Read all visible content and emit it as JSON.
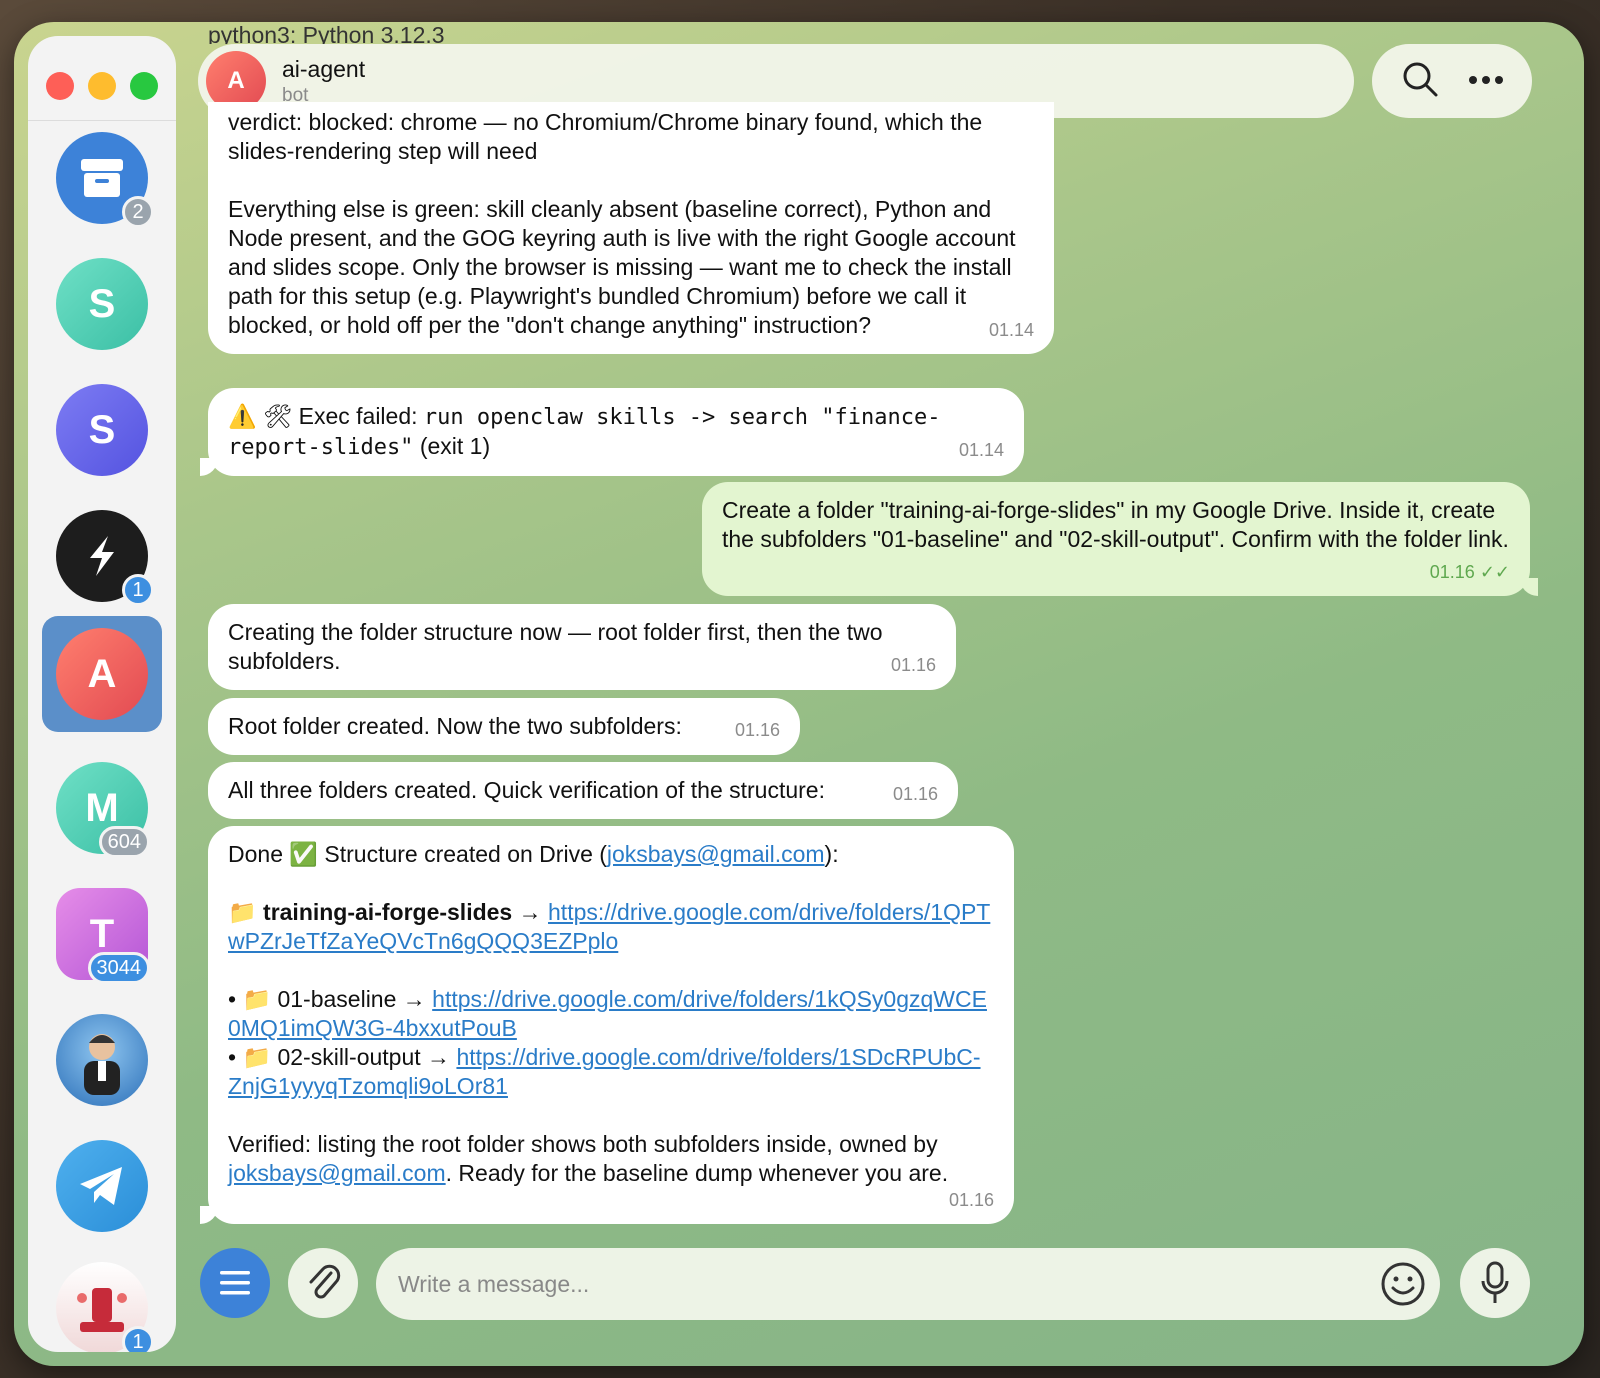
{
  "header": {
    "title": "ai-agent",
    "subtitle": "bot",
    "avatar_letter": "A",
    "behind_text": "python3: Python 3.12.3"
  },
  "sidebar": {
    "items": [
      {
        "kind": "archive",
        "badge": "2"
      },
      {
        "letter": "S",
        "badge": ""
      },
      {
        "letter": "S",
        "badge": ""
      },
      {
        "kind": "logo",
        "badge": "1"
      },
      {
        "letter": "A",
        "badge": ""
      },
      {
        "letter": "M",
        "badge": "604"
      },
      {
        "letter": "T",
        "badge": "3044"
      },
      {
        "kind": "photo",
        "badge": ""
      },
      {
        "kind": "telegram",
        "badge": ""
      },
      {
        "kind": "photo2",
        "badge": "1"
      }
    ]
  },
  "messages": {
    "m1": {
      "line1": "verdict: blocked: chrome — no Chromium/Chrome binary found, which the slides-rendering step will need",
      "para2": "Everything else is green: skill cleanly absent (baseline correct), Python and Node present, and the GOG keyring auth is live with the right Google account and slides scope. Only the browser is missing — want me to check the install path for this setup (e.g. Playwright's bundled Chromium) before we call it blocked, or hold off per the \"don't change anything\" instruction?",
      "time": "01.14"
    },
    "m2": {
      "prefix": "⚠️ 🛠 Exec failed: ",
      "code": "run openclaw skills -> search \"finance-report-slides\"",
      "suffix": " (exit 1)",
      "time": "01.14"
    },
    "m3": {
      "text": "Create a folder \"training-ai-forge-slides\" in my Google Drive. Inside it, create the subfolders \"01-baseline\" and \"02-skill-output\". Confirm with the folder link.",
      "time": "01.16",
      "check": "✓✓"
    },
    "m4": {
      "text": "Creating the folder structure now — root folder first, then the two subfolders.",
      "time": "01.16"
    },
    "m5": {
      "text": "Root folder created. Now the two subfolders:",
      "time": "01.16"
    },
    "m6": {
      "text": "All three folders created. Quick verification of the structure:",
      "time": "01.16"
    },
    "m7": {
      "intro_prefix": "Done ✅ Structure created on Drive (",
      "email": "joksbays@gmail.com",
      "intro_suffix": "):",
      "root_icon": "📁",
      "root_name": "training-ai-forge-slides",
      "arrow": " → ",
      "root_link": "https://drive.google.com/drive/folders/1QPTwPZrJeTfZaYeQVcTn6gQQQ3EZPplo",
      "sub1_prefix": "• 📁 01-baseline → ",
      "sub1_link": "https://drive.google.com/drive/folders/1kQSy0gzqWCE0MQ1imQW3G-4bxxutPouB",
      "sub2_prefix": "• 📁 02-skill-output → ",
      "sub2_link": "https://drive.google.com/drive/folders/1SDcRPUbC-ZnjG1yyyqTzomqli9oLOr81",
      "verify_prefix": "Verified: listing the root folder shows both subfolders inside, owned by ",
      "verify_email": "joksbays@gmail.com",
      "verify_suffix": ". Ready for the baseline dump whenever you are.",
      "time": "01.16"
    }
  },
  "composer": {
    "placeholder": "Write a message..."
  },
  "colors": {
    "accent": "#3d8fe0",
    "outgoing_bubble": "#e3f5d0",
    "link": "#2a7cc8"
  }
}
